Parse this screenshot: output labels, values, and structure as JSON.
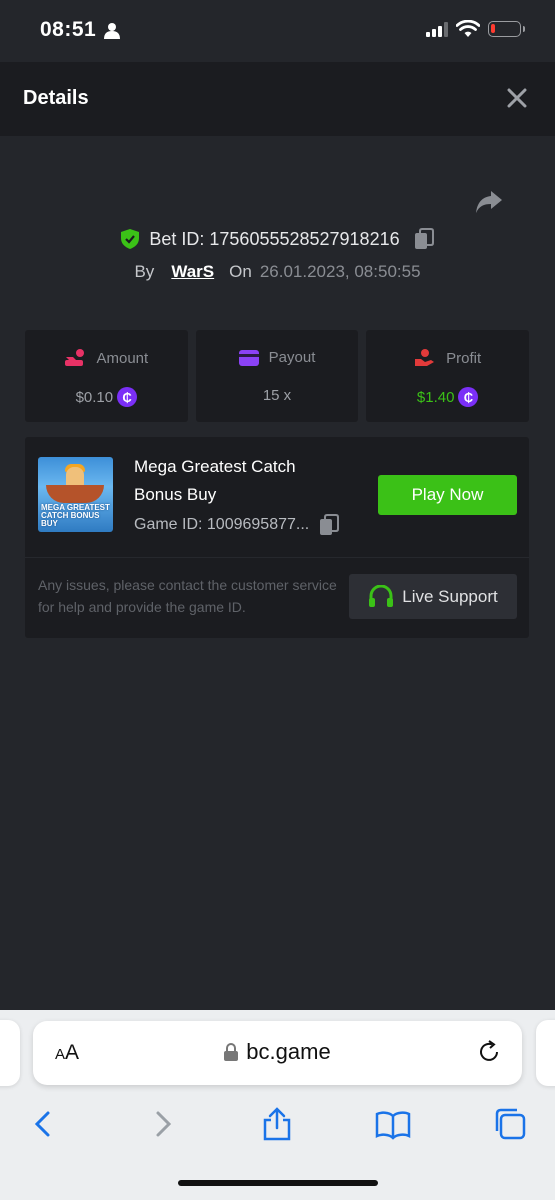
{
  "status_bar": {
    "time": "08:51"
  },
  "header": {
    "title": "Details"
  },
  "bet": {
    "id_label": "Bet ID: 1756055528527918216",
    "by_label": "By",
    "username": "WarS",
    "on_label": "On",
    "datetime": "26.01.2023, 08:50:55"
  },
  "stats": [
    {
      "label": "Amount",
      "value": "$0.10",
      "coin": "₵"
    },
    {
      "label": "Payout",
      "value": "15 x"
    },
    {
      "label": "Profit",
      "value": "$1.40",
      "coin": "₵"
    }
  ],
  "game": {
    "name": "Mega Greatest Catch Bonus Buy",
    "thumb_label": "MEGA GREATEST CATCH BONUS BUY",
    "id_label": "Game ID: 1009695877...",
    "play_label": "Play Now",
    "issue_text": "Any issues, please contact the customer service for help and provide the game ID.",
    "support_label": "Live Support"
  },
  "browser": {
    "aa_label": "AA",
    "url": "bc.game"
  },
  "colors": {
    "accent_green": "#3bc117",
    "coin_purple": "#7b2ff7",
    "background": "#24262b",
    "card": "#1b1c20"
  }
}
